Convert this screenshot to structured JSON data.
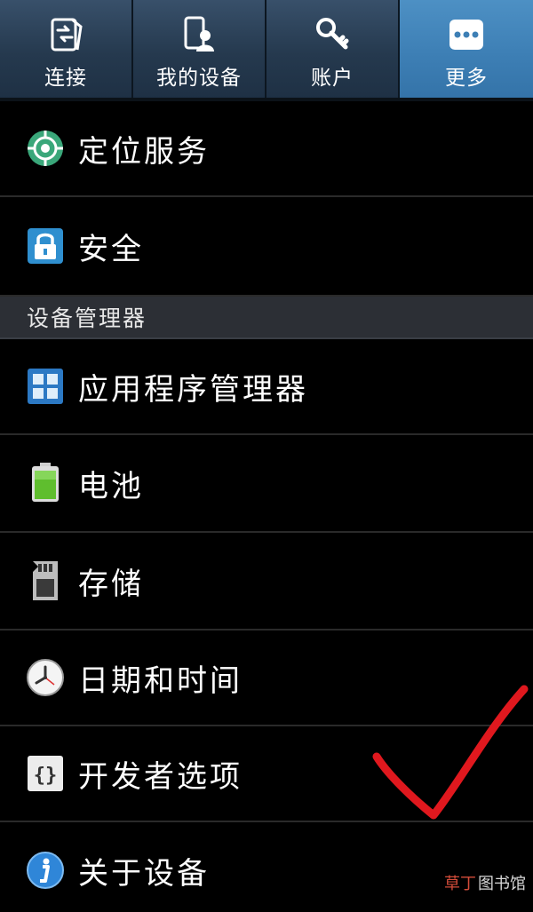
{
  "tabs": [
    {
      "label": "连接",
      "icon": "connections-icon"
    },
    {
      "label": "我的设备",
      "icon": "my-device-icon"
    },
    {
      "label": "账户",
      "icon": "accounts-icon"
    },
    {
      "label": "更多",
      "icon": "more-icon",
      "active": true
    }
  ],
  "list": {
    "items_top": [
      {
        "label": "定位服务",
        "icon": "location-icon"
      },
      {
        "label": "安全",
        "icon": "lock-icon"
      }
    ],
    "section_header": "设备管理器",
    "items_bottom": [
      {
        "label": "应用程序管理器",
        "icon": "app-manager-icon"
      },
      {
        "label": "电池",
        "icon": "battery-icon"
      },
      {
        "label": "存储",
        "icon": "sd-card-icon"
      },
      {
        "label": "日期和时间",
        "icon": "clock-icon"
      },
      {
        "label": "开发者选项",
        "icon": "braces-icon"
      },
      {
        "label": "关于设备",
        "icon": "info-icon"
      }
    ]
  },
  "watermark": {
    "part_a": "草丁",
    "part_b": "图书馆"
  },
  "colors": {
    "active_tab": "#3d7fb5",
    "tab_bg": "#25394e",
    "section_header_bg": "#2c2f35",
    "checkmark": "#e0181e"
  }
}
